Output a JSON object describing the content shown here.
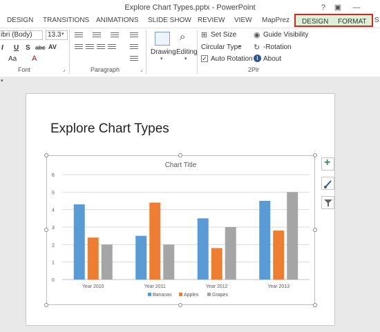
{
  "window": {
    "title": "Explore Chart Types.pptx - PowerPoint",
    "help_label": "?",
    "restore_label": "▣",
    "minimize_label": "—"
  },
  "tabs": {
    "items": [
      "DESIGN",
      "TRANSITIONS",
      "ANIMATIONS",
      "SLIDE SHOW",
      "REVIEW",
      "VIEW",
      "MapPrez"
    ],
    "context": [
      "DESIGN",
      "FORMAT"
    ],
    "overflow": "S"
  },
  "ribbon": {
    "font": {
      "name": "ibri (Body)",
      "size": "13.3",
      "label": "Font",
      "underline": "U",
      "strike": "S",
      "strike_abc": "abc",
      "spacing": "AV",
      "case": "Aa",
      "italic": "I"
    },
    "paragraph": {
      "label": "Paragraph"
    },
    "drawing": {
      "label": "Drawing"
    },
    "editing": {
      "label": "Editing"
    },
    "plugin": {
      "label": "2Plr",
      "set_size": "Set Size",
      "circular_type": "Circular Type",
      "auto_rotation": "Auto Rotation",
      "auto_rotation_checked": true,
      "guide_visibility": "Guide Visibility",
      "rotation": "-Rotation",
      "about": "About"
    }
  },
  "slide": {
    "title": "Explore Chart Types"
  },
  "chart_data": {
    "type": "bar",
    "title": "Chart Title",
    "categories": [
      "Year 2010",
      "Year 2011",
      "Year 2012",
      "Year 2013"
    ],
    "series": [
      {
        "name": "Bananas",
        "values": [
          4.3,
          2.5,
          3.5,
          4.5
        ],
        "color": "#5b9bd5"
      },
      {
        "name": "Apples",
        "values": [
          2.4,
          4.4,
          1.8,
          2.8
        ],
        "color": "#ed7d31"
      },
      {
        "name": "Grapes",
        "values": [
          2.0,
          2.0,
          3.0,
          5.0
        ],
        "color": "#a5a5a5"
      }
    ],
    "ylim": [
      0,
      6
    ],
    "yticks": [
      "0",
      "1",
      "2",
      "3",
      "4",
      "5",
      "6"
    ],
    "grid": true,
    "legend": "bottom"
  },
  "chart_tools": {
    "add_label": "+"
  },
  "colors": {
    "context_tab_highlight": "#dff0d8",
    "context_tab_border": "#d9241b",
    "ribbon_accent": "#2b579a"
  }
}
